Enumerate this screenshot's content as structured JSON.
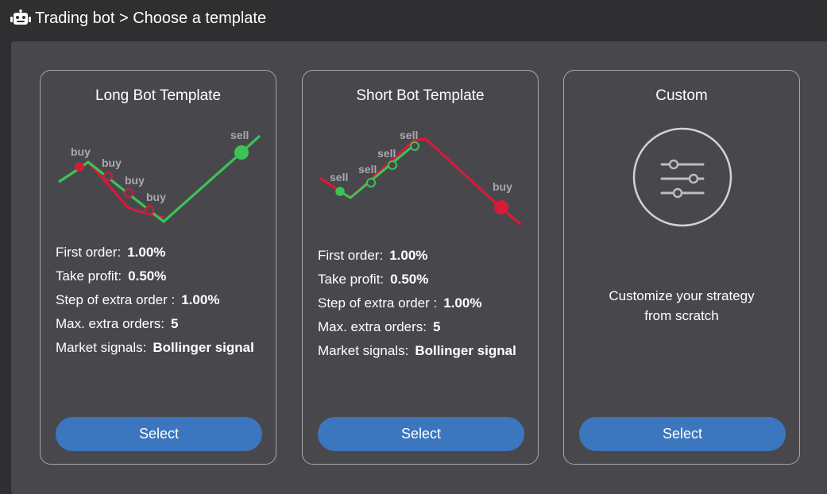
{
  "header": {
    "title": "Trading bot > Choose a template",
    "icon": "robot-icon"
  },
  "colors": {
    "green": "#3cc356",
    "red": "#d61a3c",
    "button": "#3c76bf",
    "card_border": "#a7a7ab",
    "panel": "#48484c"
  },
  "templates": [
    {
      "title": "Long Bot Template",
      "labels": [
        "buy",
        "buy",
        "buy",
        "buy",
        "sell"
      ],
      "stats": [
        {
          "label": "First order:",
          "value": "1.00%"
        },
        {
          "label": "Take profit:",
          "value": "0.50%"
        },
        {
          "label": "Step of extra order :",
          "value": "1.00%"
        },
        {
          "label": "Max. extra orders:",
          "value": "5"
        },
        {
          "label": "Market signals:",
          "value": "Bollinger signal"
        }
      ],
      "button": "Select"
    },
    {
      "title": "Short Bot Template",
      "labels": [
        "sell",
        "sell",
        "sell",
        "sell",
        "buy"
      ],
      "stats": [
        {
          "label": "First order:",
          "value": "1.00%"
        },
        {
          "label": "Take profit:",
          "value": "0.50%"
        },
        {
          "label": "Step of extra order :",
          "value": "1.00%"
        },
        {
          "label": "Max. extra orders:",
          "value": "5"
        },
        {
          "label": "Market signals:",
          "value": "Bollinger signal"
        }
      ],
      "button": "Select"
    },
    {
      "title": "Custom",
      "icon": "sliders-icon",
      "description_line1": "Customize your strategy",
      "description_line2": "from scratch",
      "button": "Select"
    }
  ]
}
